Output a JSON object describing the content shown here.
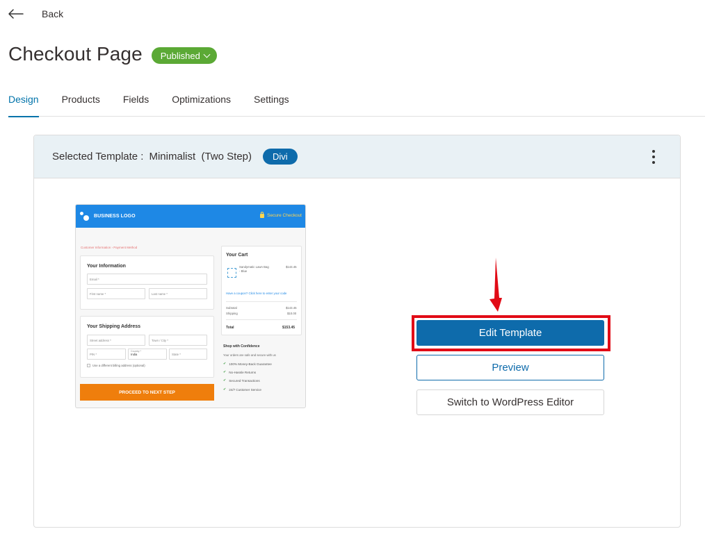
{
  "nav": {
    "back_label": "Back",
    "back_icon": "arrow-left-icon"
  },
  "header": {
    "title": "Checkout Page",
    "status": "Published"
  },
  "tabs": [
    {
      "label": "Design",
      "active": true
    },
    {
      "label": "Products",
      "active": false
    },
    {
      "label": "Fields",
      "active": false
    },
    {
      "label": "Optimizations",
      "active": false
    },
    {
      "label": "Settings",
      "active": false
    }
  ],
  "template": {
    "label": "Selected Template :",
    "name": "Minimalist  (Two Step)",
    "builder": "Divi",
    "menu_icon": "kebab-menu-icon"
  },
  "preview": {
    "logo": "BUSINESS LOGO",
    "secure": "Secure Checkout",
    "breadcrumb": "Customer Information  ›  Payment Method",
    "info_title": "Your Information",
    "email": "Email *",
    "first_name": "First name *",
    "last_name": "Last name *",
    "shipping_title": "Your Shipping Address",
    "street": "Street address *",
    "town": "Town / City *",
    "pin": "PIN *",
    "country_label": "Country *",
    "country_value": "India",
    "state": "State *",
    "billing_note": "Use a different billing address (optional)",
    "proceed": "PROCEED TO NEXT STEP",
    "cart_title": "Your Cart",
    "product_name": "Sandymatic Lawn Bag - Blue",
    "product_price": "$143.45",
    "coupon": "Have a coupon? Click here to enter your code",
    "subtotal_label": "Subtotal",
    "subtotal_value": "$143.45",
    "shipping_label": "Shipping",
    "shipping_value": "$10.00",
    "total_label": "Total",
    "total_value": "$153.45",
    "confidence_title": "Shop with Confidence",
    "confidence_sub": "Your orders are safe and secure with us",
    "features": [
      "100% Money-Back Guarantee",
      "No-Hassle Returns",
      "Secured Transactions",
      "24/7 Customer Service"
    ]
  },
  "actions": {
    "edit": "Edit Template",
    "preview": "Preview",
    "switch": "Switch to WordPress Editor"
  },
  "colors": {
    "accent": "#0e6bab",
    "published": "#5ba935",
    "highlight": "#e10b16"
  }
}
